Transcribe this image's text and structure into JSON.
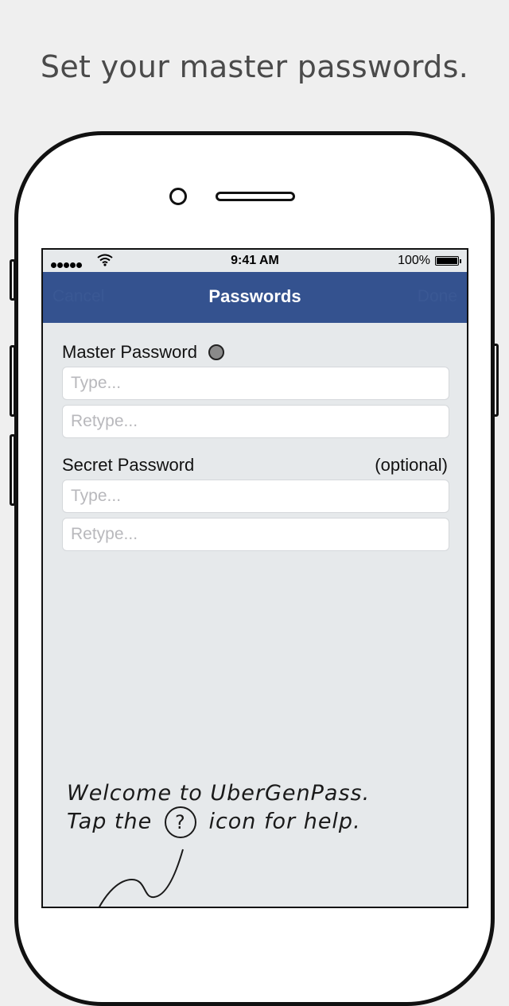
{
  "headline": "Set your master passwords.",
  "status_bar": {
    "time": "9:41 AM",
    "battery_percent": "100%"
  },
  "nav": {
    "title": "Passwords",
    "cancel_label": "Cancel",
    "done_label": "Done"
  },
  "master": {
    "label": "Master Password",
    "type_placeholder": "Type...",
    "retype_placeholder": "Retype..."
  },
  "secret": {
    "label": "Secret Password",
    "optional_label": "(optional)",
    "type_placeholder": "Type...",
    "retype_placeholder": "Retype..."
  },
  "hint": {
    "line1": "Welcome to UberGenPass.",
    "line2_before": "Tap the",
    "help_symbol": "?",
    "line2_after": "icon for help."
  },
  "colors": {
    "nav_background": "#34528f",
    "screen_background": "#e6e9eb",
    "status_indicator": "#8a8a8a"
  }
}
